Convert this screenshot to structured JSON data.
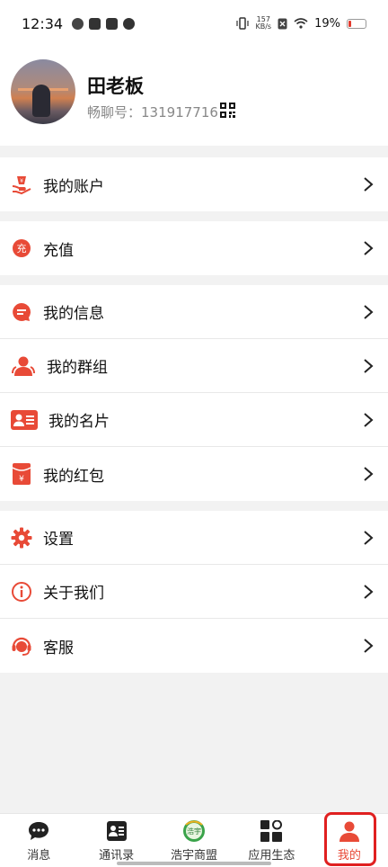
{
  "status_bar": {
    "time": "12:34",
    "net_speed_top": "157",
    "net_speed_bottom": "KB/s",
    "battery": "19%",
    "battery_level": 0.19
  },
  "profile": {
    "name": "田老板",
    "id_label": "畅聊号：",
    "id_value": "131917716"
  },
  "menu": {
    "account": "我的账户",
    "recharge": "充值",
    "messages": "我的信息",
    "groups": "我的群组",
    "card": "我的名片",
    "redpacket": "我的红包",
    "settings": "设置",
    "about": "关于我们",
    "service": "客服"
  },
  "icons": {
    "recharge_glyph": "充",
    "accent": "#e84a37"
  },
  "nav": {
    "messages": "消息",
    "contacts": "通讯录",
    "alliance": "浩宇商盟",
    "apps": "应用生态",
    "me": "我的",
    "alliance_logo_text": "浩宇"
  }
}
